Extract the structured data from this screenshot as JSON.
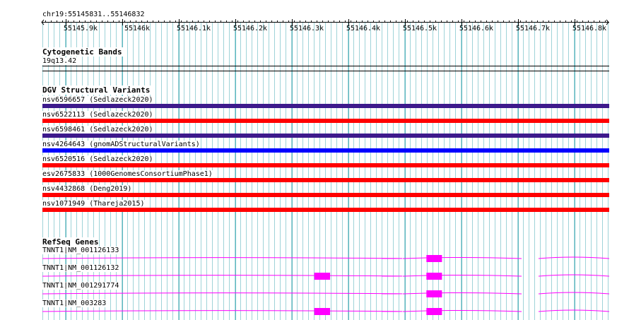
{
  "ruler": {
    "location": "chr19:55145831..55146832",
    "ticks": [
      "55145.9k",
      "55146k",
      "55146.1k",
      "55146.2k",
      "55146.3k",
      "55146.4k",
      "55146.5k",
      "55146.6k",
      "55146.7k",
      "55146.8k"
    ]
  },
  "cytobands": {
    "title": "Cytogenetic Bands",
    "band": "19q13.42"
  },
  "dgv": {
    "title": "DGV Structural Variants",
    "variants": [
      {
        "label": "nsv6596657 (Sedlazeck2020)",
        "color": "#3d1a8c"
      },
      {
        "label": "nsv6522113 (Sedlazeck2020)",
        "color": "#ff0000"
      },
      {
        "label": "nsv6598461 (Sedlazeck2020)",
        "color": "#3d1a8c"
      },
      {
        "label": "nsv4264643 (gnomADStructuralVariants)",
        "color": "#0000ff"
      },
      {
        "label": "nsv6520516 (Sedlazeck2020)",
        "color": "#ff0000"
      },
      {
        "label": "esv2675833 (1000GenomesConsortiumPhase1)",
        "color": "#ff0000"
      },
      {
        "label": "nsv4432868 (Deng2019)",
        "color": "#ff0000"
      },
      {
        "label": "nsv1071949 (Thareja2015)",
        "color": "#ff0000"
      }
    ]
  },
  "refseq": {
    "title": "RefSeq Genes",
    "color": "#ff00ff",
    "genes": [
      {
        "label": "TNNT1|NM_001126133"
      },
      {
        "label": "TNNT1|NM_001126132"
      },
      {
        "label": "TNNT1|NM_001291774"
      },
      {
        "label": "TNNT1|NM_003283"
      }
    ]
  },
  "colors": {
    "grid_line": "#9fd3d8",
    "grid_line_major": "#5fb8c0"
  }
}
